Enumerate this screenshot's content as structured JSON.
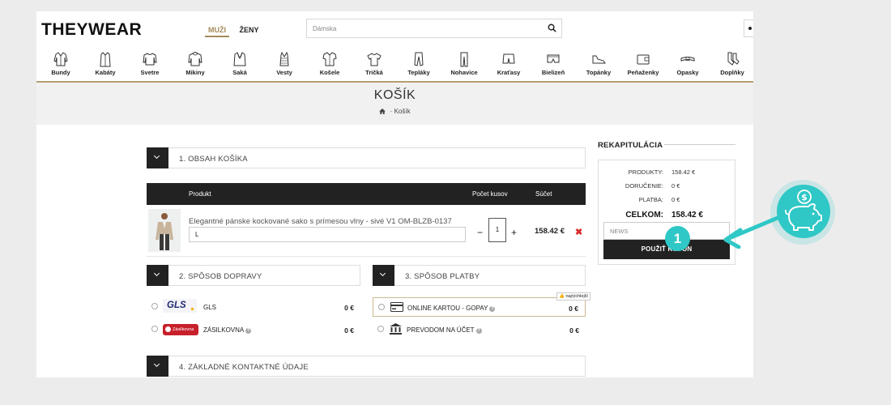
{
  "header": {
    "logo": "THEYWEAR",
    "gender_tabs": [
      {
        "label": "MUŽI",
        "active": true
      },
      {
        "label": "ŽENY",
        "active": false
      }
    ],
    "search": {
      "value": "Dámska",
      "icon": "search-icon"
    }
  },
  "categories": [
    {
      "label": "Bundy",
      "icon": "jacket-icon"
    },
    {
      "label": "Kabáty",
      "icon": "coat-icon"
    },
    {
      "label": "Svetre",
      "icon": "sweater-icon"
    },
    {
      "label": "Mikiny",
      "icon": "hoodie-icon"
    },
    {
      "label": "Saká",
      "icon": "blazer-icon"
    },
    {
      "label": "Vesty",
      "icon": "vest-icon"
    },
    {
      "label": "Košele",
      "icon": "shirt-icon"
    },
    {
      "label": "Tričká",
      "icon": "tshirt-icon"
    },
    {
      "label": "Tepláky",
      "icon": "sweatpants-icon"
    },
    {
      "label": "Nohavice",
      "icon": "trousers-icon"
    },
    {
      "label": "Kraťasy",
      "icon": "shorts-icon"
    },
    {
      "label": "Bielizeň",
      "icon": "underwear-icon"
    },
    {
      "label": "Topánky",
      "icon": "shoe-icon"
    },
    {
      "label": "Peňaženky",
      "icon": "wallet-icon"
    },
    {
      "label": "Opasky",
      "icon": "belt-icon"
    },
    {
      "label": "Doplňky",
      "icon": "socks-icon"
    }
  ],
  "banner": {
    "title": "KOŠÍK",
    "breadcrumb": "Košík",
    "home_icon": "home-icon"
  },
  "steps": {
    "content": "1. OBSAH KOŠÍKA",
    "shipping": "2. SPÔSOB DOPRAVY",
    "payment": "3. SPÔSOB PLATBY",
    "contact": "4. ZÁKLADNÉ KONTAKTNÉ ÚDAJE"
  },
  "cart": {
    "columns": {
      "product": "Produkt",
      "qty": "Počet kusov",
      "total": "Súčet"
    },
    "item": {
      "name": "Elegantné pánske kockované sako s prímesou vlny - sivé V1 OM-BLZB-0137",
      "size": "L",
      "minus": "−",
      "qty": "1",
      "plus": "+",
      "price": "158.42 €",
      "remove": "✖"
    }
  },
  "shipping": [
    {
      "name": "GLS",
      "price": "0 €",
      "logo": "GLS"
    },
    {
      "name": "ZÁSILKOVNA",
      "price": "0 €",
      "logo": "Zásilkovna"
    }
  ],
  "payment": [
    {
      "name": "ONLINE KARTOU - GOPAY",
      "price": "0 €",
      "icon": "card-icon",
      "badge": "najrýchlejší"
    },
    {
      "name": "PREVODOM NA ÚČET",
      "price": "0 €",
      "icon": "bank-icon"
    }
  ],
  "summary": {
    "title": "REKAPITULÁCIA",
    "rows": [
      {
        "label": "PRODUKTY:",
        "value": "158.42 €"
      },
      {
        "label": "DORUČENIE:",
        "value": "0 €"
      },
      {
        "label": "PLATBA:",
        "value": "0 €"
      }
    ],
    "total": {
      "label": "CELKOM:",
      "value": "158.42 €"
    },
    "coupon_placeholder": "NEWS",
    "apply_label": "POUŽIŤ KUPÓN"
  },
  "annotation": {
    "badge": "1",
    "icon": "piggy-bank-icon"
  },
  "colors": {
    "accent": "#b59d72",
    "dark": "#222222",
    "teal": "#2fc8c6",
    "remove": "#d92b2b"
  }
}
